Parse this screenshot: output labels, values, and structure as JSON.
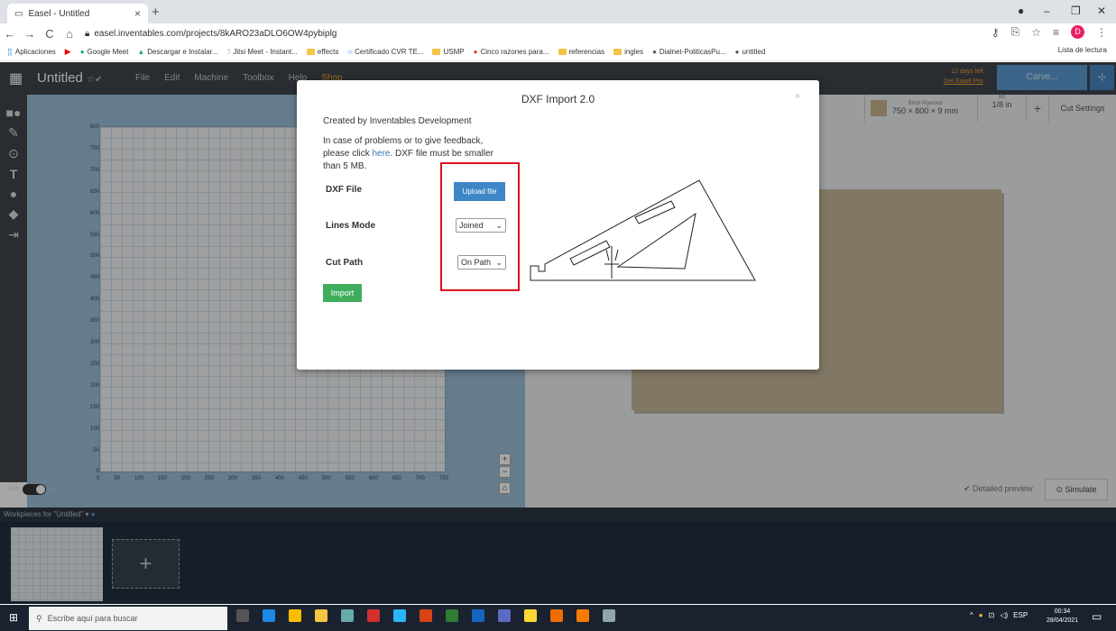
{
  "browser": {
    "tab_title": "Easel - Untitled",
    "tab_close": "×",
    "new_tab": "+",
    "url": "easel.inventables.com/projects/8kARO23aDLO6OW4pybiplg",
    "bookmarks": [
      "Aplicaciones",
      "Google Meet",
      "Descargar e Instalar...",
      "Jitsi Meet - Instant...",
      "effects",
      "Certificado CVR TE...",
      "USMP",
      "Cinco razones para...",
      "referencias",
      "ingles",
      "Dialnet-PoliticasPu...",
      "untitled"
    ],
    "reading_list": "Lista de lectura",
    "profile_initial": "D"
  },
  "easel": {
    "title": "Untitled",
    "menu": [
      "File",
      "Edit",
      "Machine",
      "Toolbox",
      "Help",
      "Shop"
    ],
    "days_left": "12 days left",
    "get_pro": "Get Easel Pro",
    "carve": "Carve...",
    "material_name": "Birch Plywood",
    "material_dims": "750 × 800 × 9 mm",
    "bit_label": "Bit",
    "bit_value": "1/8 in",
    "cut_settings": "Cut Settings",
    "y_ticks": [
      "800",
      "750",
      "700",
      "650",
      "600",
      "550",
      "500",
      "450",
      "400",
      "350",
      "300",
      "250",
      "200",
      "150",
      "100",
      "50",
      "0"
    ],
    "x_ticks": [
      "0",
      "50",
      "100",
      "150",
      "200",
      "250",
      "300",
      "350",
      "400",
      "450",
      "500",
      "550",
      "600",
      "650",
      "700",
      "750"
    ],
    "unit_inch": "inch",
    "unit_mm": "mm",
    "detailed_preview": "✔ Detailed preview",
    "simulate": "Simulate",
    "workpieces_label": "Workpieces for \"Untitled\""
  },
  "modal": {
    "title": "DXF Import 2.0",
    "close": "×",
    "created_by": "Created by Inventables Development",
    "problems_prefix": "In case of problems or to give feedback, please click ",
    "problems_link": "here",
    "problems_suffix": ". DXF file must be smaller than 5 MB.",
    "dxf_file_label": "DXF File",
    "upload_button": "Upload file",
    "lines_mode_label": "Lines Mode",
    "lines_mode_value": "Joined",
    "cut_path_label": "Cut Path",
    "cut_path_value": "On Path",
    "import_button": "Import"
  },
  "taskbar": {
    "search_placeholder": "Escribe aquí para buscar",
    "lang": "ESP",
    "time": "00:34",
    "date": "28/04/2021"
  }
}
